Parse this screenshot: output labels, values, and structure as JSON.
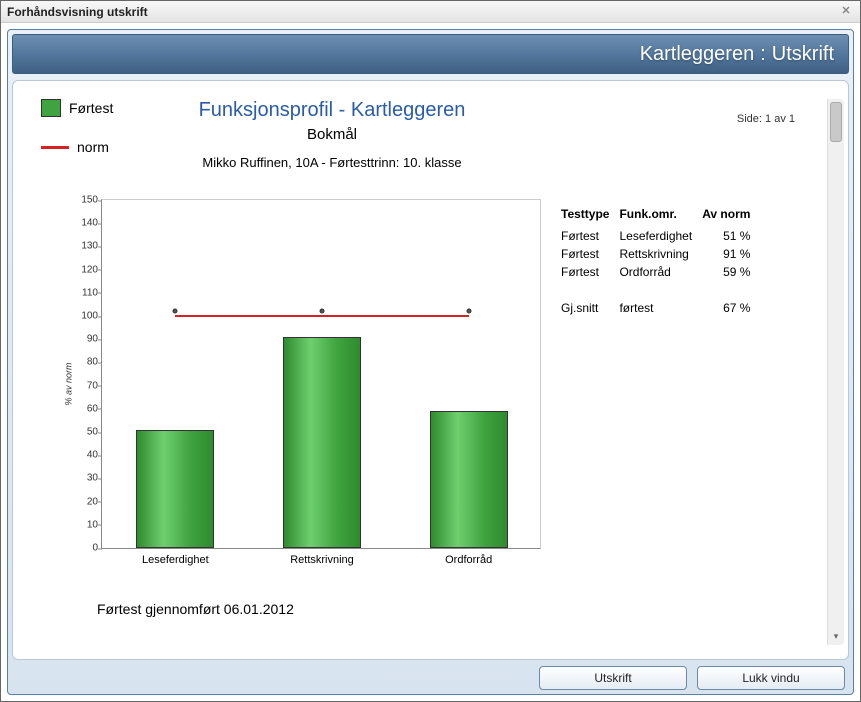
{
  "window": {
    "title": "Forhåndsvisning utskrift",
    "close_tooltip": "Lukk"
  },
  "banner": {
    "app": "Kartleggeren",
    "section": "Utskrift"
  },
  "page_indicator": "Side: 1 av 1",
  "legend": {
    "series_label": "Førtest",
    "norm_label": "norm"
  },
  "titles": {
    "main": "Funksjonsprofil - Kartleggeren",
    "sub": "Bokmål",
    "meta": "Mikko Ruffinen, 10A - Førtesttrinn: 10. klasse"
  },
  "chart_data": {
    "type": "bar",
    "categories": [
      "Leseferdighet",
      "Rettskrivning",
      "Ordforråd"
    ],
    "values": [
      51,
      91,
      59
    ],
    "norm": 100,
    "ylabel": "% av norm",
    "ylim": [
      0,
      150
    ],
    "ystep": 10
  },
  "table": {
    "headers": [
      "Testtype",
      "Funk.omr.",
      "Av norm"
    ],
    "rows": [
      [
        "Førtest",
        "Leseferdighet",
        "51 %"
      ],
      [
        "Førtest",
        "Rettskrivning",
        "91 %"
      ],
      [
        "Førtest",
        "Ordforråd",
        "59 %"
      ]
    ],
    "summary": [
      "Gj.snitt",
      "førtest",
      "67 %"
    ]
  },
  "footer_note": "Førtest gjennomført 06.01.2012",
  "buttons": {
    "print": "Utskrift",
    "close": "Lukk vindu"
  }
}
